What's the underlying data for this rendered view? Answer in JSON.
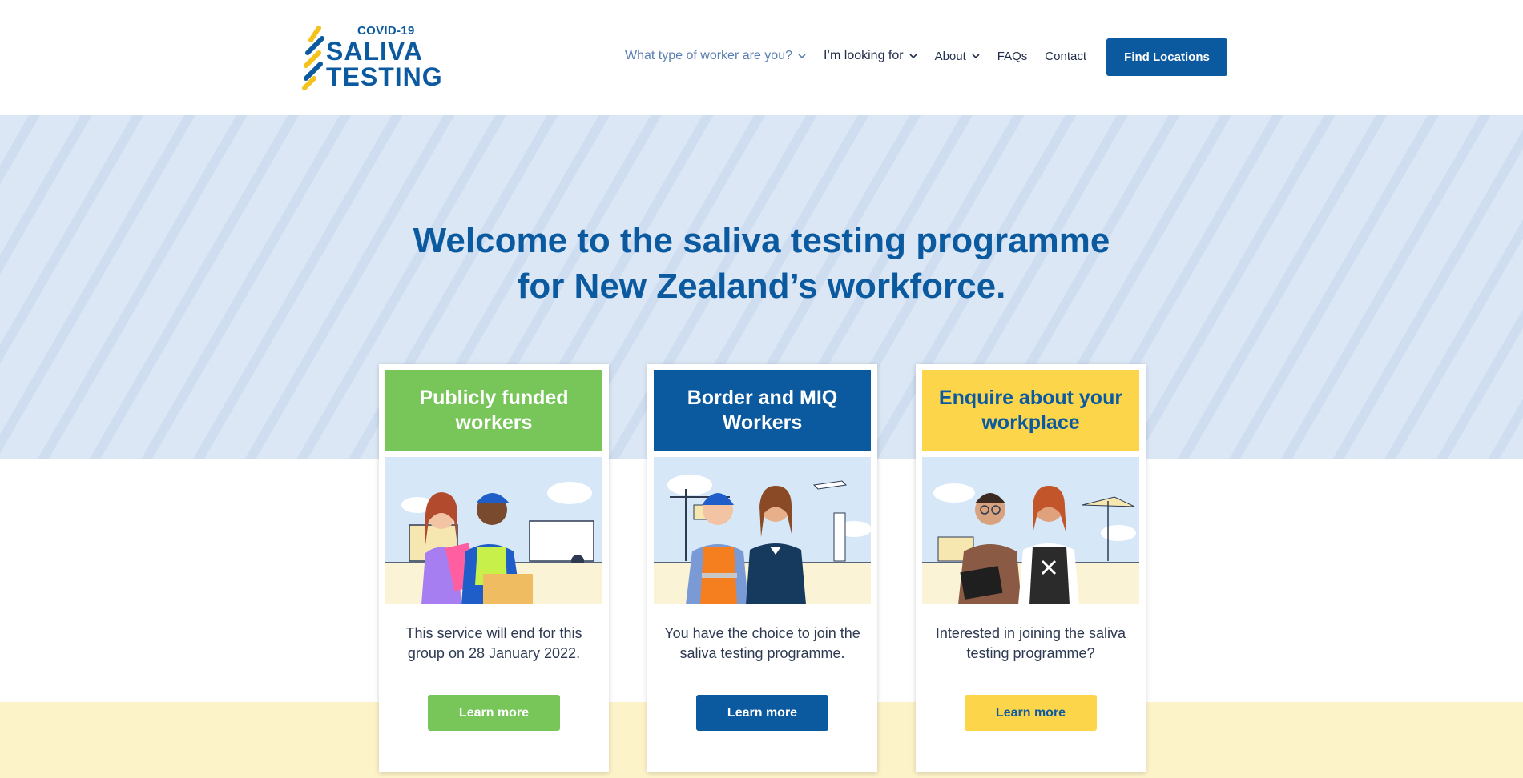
{
  "brand": {
    "small": "COVID-19",
    "line1": "SALIVA",
    "line2": "TESTING",
    "colors": {
      "primary": "#0b5aa0",
      "green": "#78c55a",
      "yellow": "#fdd54a",
      "hero_bg": "#dbe7f5",
      "footer_bg": "#fdf3c9"
    }
  },
  "nav": {
    "items": [
      {
        "label": "What type of worker are you?",
        "icon": "chevron-down-icon"
      },
      {
        "label": "I’m looking for",
        "icon": "chevron-down-icon"
      },
      {
        "label": "About",
        "icon": "chevron-down-icon"
      },
      {
        "label": "FAQs"
      },
      {
        "label": "Contact"
      }
    ],
    "cta": "Find Locations"
  },
  "hero": {
    "title_line1": "Welcome to the saliva testing programme",
    "title_line2": "for New Zealand’s workforce."
  },
  "cards": [
    {
      "title": "Publicly funded workers",
      "text": "This service will end for this group on 28 January 2022.",
      "button": "Learn more",
      "illustration": "publicly-funded-workers-illustration"
    },
    {
      "title": "Border and MIQ Workers",
      "text": "You have the choice to join the saliva testing programme.",
      "button": "Learn more",
      "illustration": "border-miq-workers-illustration"
    },
    {
      "title": "Enquire about your workplace",
      "text": "Interested in joining the saliva testing programme?",
      "button": "Learn more",
      "illustration": "workplace-enquiry-illustration"
    }
  ]
}
